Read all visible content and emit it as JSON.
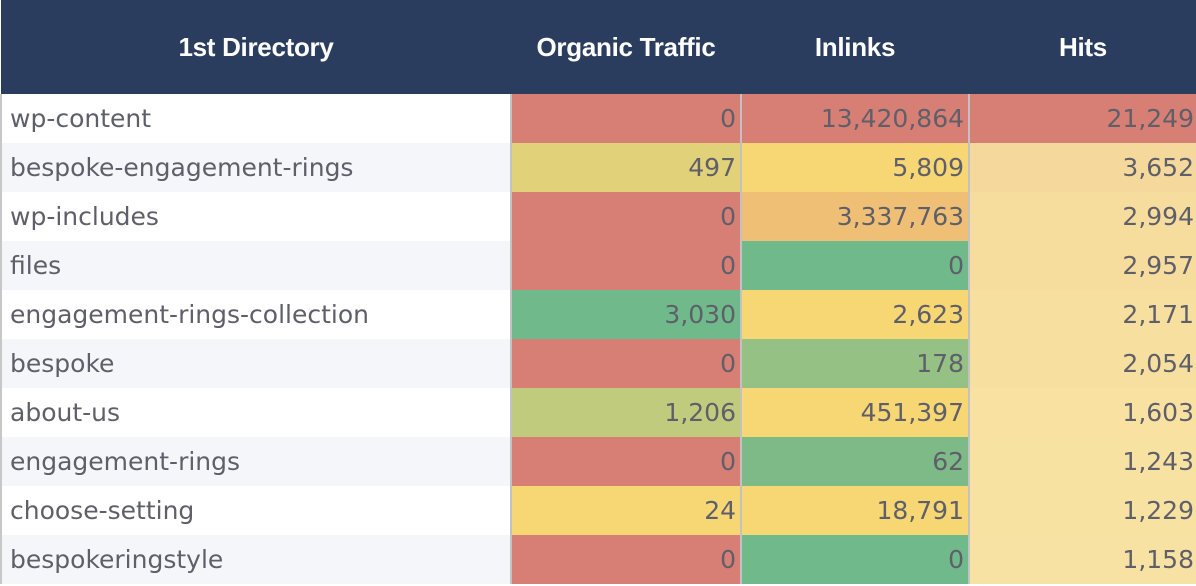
{
  "table": {
    "headers": [
      "1st Directory",
      "Organic Traffic",
      "Inlinks",
      "Hits"
    ],
    "rows": [
      {
        "dir": "wp-content",
        "organic": "0",
        "inlinks": "13,420,864",
        "hits": "21,249",
        "colors": {
          "organic": "#d77f74",
          "inlinks": "#d77f74",
          "hits": "#d77f74"
        }
      },
      {
        "dir": "bespoke-engagement-rings",
        "organic": "497",
        "inlinks": "5,809",
        "hits": "3,652",
        "colors": {
          "organic": "#e1d27a",
          "inlinks": "#f7d674",
          "hits": "#f5d99c"
        }
      },
      {
        "dir": "wp-includes",
        "organic": "0",
        "inlinks": "3,337,763",
        "hits": "2,994",
        "colors": {
          "organic": "#d77f74",
          "inlinks": "#eebf74",
          "hits": "#f6dd9e"
        }
      },
      {
        "dir": "files",
        "organic": "0",
        "inlinks": "0",
        "hits": "2,957",
        "colors": {
          "organic": "#d77f74",
          "inlinks": "#70b98b",
          "hits": "#f6dd9e"
        }
      },
      {
        "dir": "engagement-rings-collection",
        "organic": "3,030",
        "inlinks": "2,623",
        "hits": "2,171",
        "colors": {
          "organic": "#70b98b",
          "inlinks": "#f7d674",
          "hits": "#f7dfa0"
        }
      },
      {
        "dir": "bespoke",
        "organic": "0",
        "inlinks": "178",
        "hits": "2,054",
        "colors": {
          "organic": "#d77f74",
          "inlinks": "#95c284",
          "hits": "#f7dfa0"
        }
      },
      {
        "dir": "about-us",
        "organic": "1,206",
        "inlinks": "451,397",
        "hits": "1,603",
        "colors": {
          "organic": "#c0cb7d",
          "inlinks": "#f7d674",
          "hits": "#f8e1a1"
        }
      },
      {
        "dir": "engagement-rings",
        "organic": "0",
        "inlinks": "62",
        "hits": "1,243",
        "colors": {
          "organic": "#d77f74",
          "inlinks": "#7dba88",
          "hits": "#f8e2a2"
        }
      },
      {
        "dir": "choose-setting",
        "organic": "24",
        "inlinks": "18,791",
        "hits": "1,229",
        "colors": {
          "organic": "#f7d674",
          "inlinks": "#f7d674",
          "hits": "#f8e2a2"
        }
      },
      {
        "dir": "bespokeringstyle",
        "organic": "0",
        "inlinks": "0",
        "hits": "1,158",
        "colors": {
          "organic": "#d77f74",
          "inlinks": "#70b98b",
          "hits": "#f8e2a3"
        }
      }
    ]
  },
  "colors": {
    "header_bg": "#2b3d5e",
    "header_text": "#ffffff",
    "cell_text": "#5f5f6a"
  }
}
